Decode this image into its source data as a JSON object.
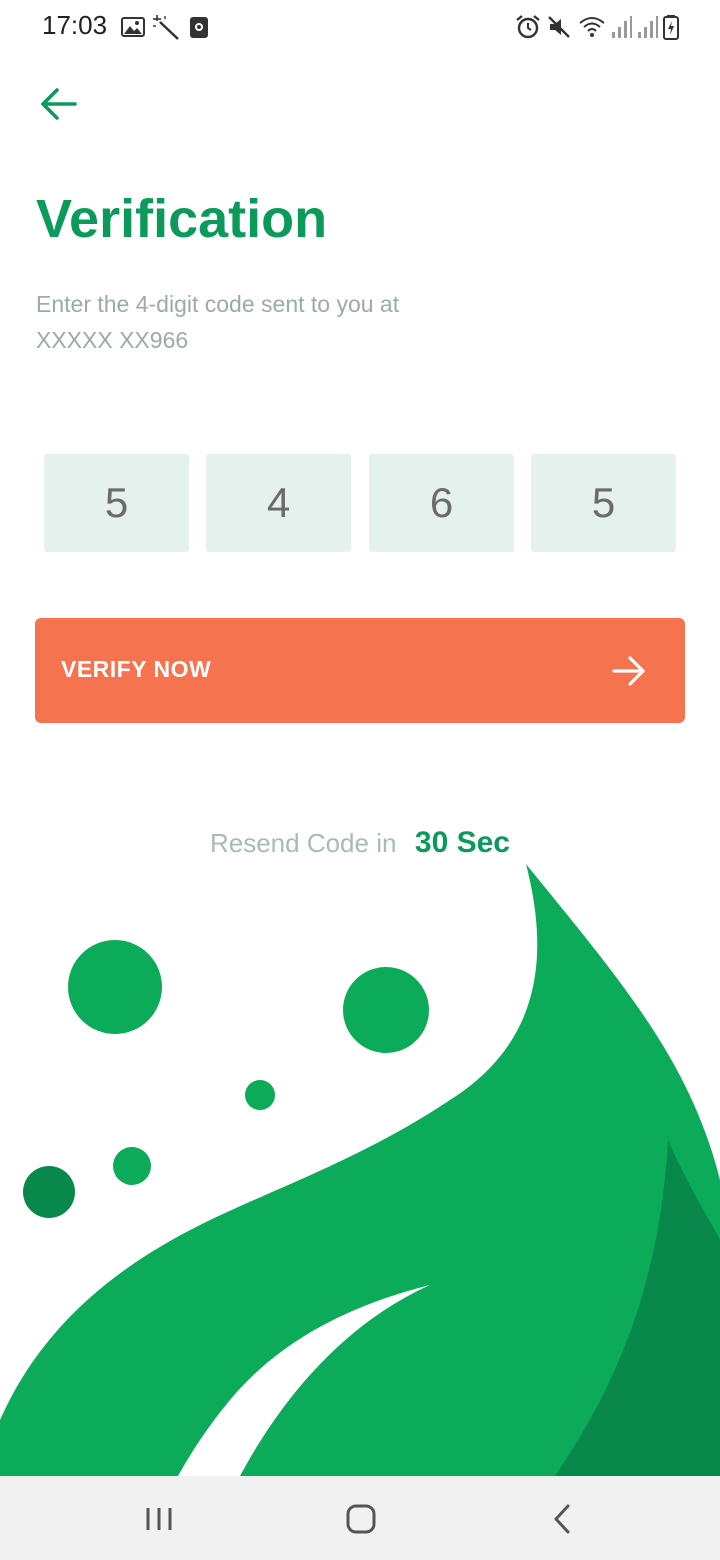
{
  "status_bar": {
    "time": "17:03",
    "icons": [
      "gallery-icon",
      "magic-wand-icon",
      "screen-recorder-icon",
      "alarm-icon",
      "mute-icon",
      "wifi-icon",
      "signal-icon",
      "signal-icon",
      "battery-charging-icon"
    ]
  },
  "header": {
    "back_icon": "arrow-left-icon",
    "title": "Verification"
  },
  "instructions": {
    "line1": "Enter the 4-digit code sent to you at",
    "line2": "XXXXX XX966"
  },
  "code": {
    "digits": [
      "5",
      "4",
      "6",
      "5"
    ]
  },
  "verify_button": {
    "label": "VERIFY NOW",
    "icon": "arrow-right-icon"
  },
  "resend": {
    "label": "Resend Code in",
    "timer": "30 Sec"
  },
  "nav_bar": {
    "buttons": [
      "recent-apps-icon",
      "home-icon",
      "back-icon"
    ]
  },
  "colors": {
    "brand_green": "#0c9a5b",
    "leaf_green": "#0cab59",
    "leaf_dark": "#08884a",
    "accent_orange": "#f5734f",
    "code_box_bg": "#e4f1ec",
    "muted_text": "#9aaca3"
  }
}
